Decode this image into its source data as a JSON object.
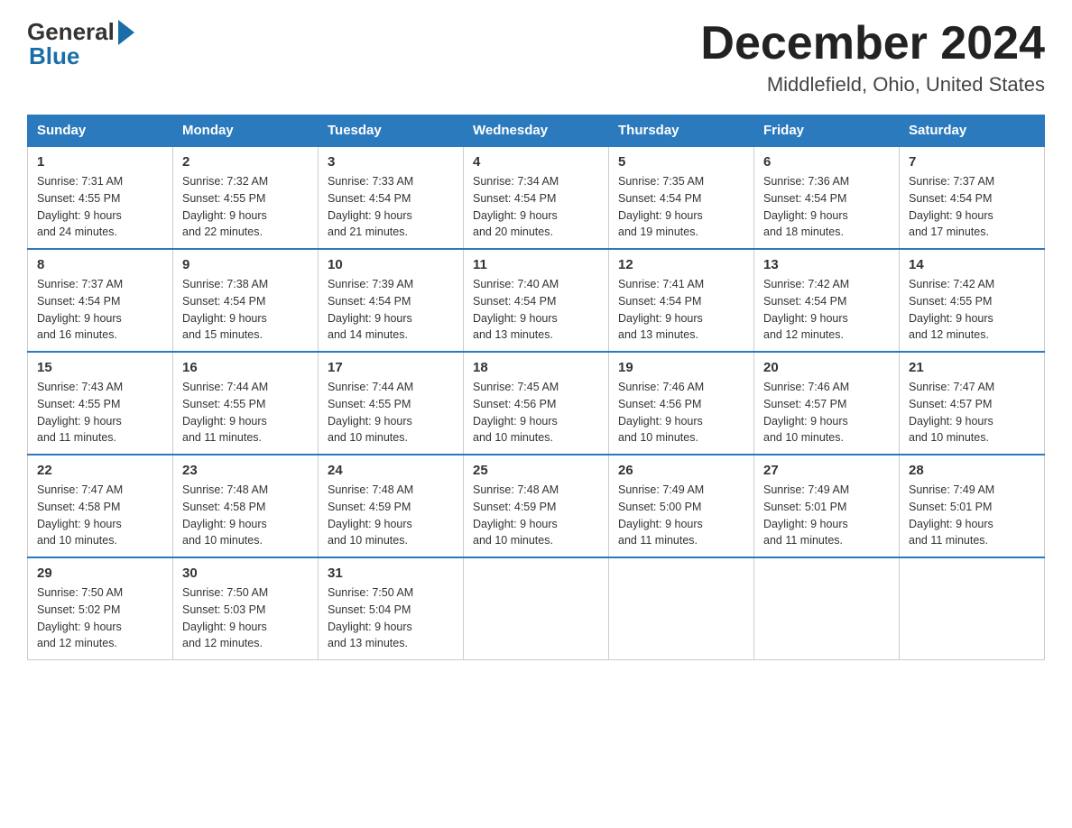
{
  "logo": {
    "general": "General",
    "blue": "Blue"
  },
  "title": "December 2024",
  "location": "Middlefield, Ohio, United States",
  "days_of_week": [
    "Sunday",
    "Monday",
    "Tuesday",
    "Wednesday",
    "Thursday",
    "Friday",
    "Saturday"
  ],
  "weeks": [
    [
      {
        "day": "1",
        "sunrise": "7:31 AM",
        "sunset": "4:55 PM",
        "daylight": "9 hours and 24 minutes."
      },
      {
        "day": "2",
        "sunrise": "7:32 AM",
        "sunset": "4:55 PM",
        "daylight": "9 hours and 22 minutes."
      },
      {
        "day": "3",
        "sunrise": "7:33 AM",
        "sunset": "4:54 PM",
        "daylight": "9 hours and 21 minutes."
      },
      {
        "day": "4",
        "sunrise": "7:34 AM",
        "sunset": "4:54 PM",
        "daylight": "9 hours and 20 minutes."
      },
      {
        "day": "5",
        "sunrise": "7:35 AM",
        "sunset": "4:54 PM",
        "daylight": "9 hours and 19 minutes."
      },
      {
        "day": "6",
        "sunrise": "7:36 AM",
        "sunset": "4:54 PM",
        "daylight": "9 hours and 18 minutes."
      },
      {
        "day": "7",
        "sunrise": "7:37 AM",
        "sunset": "4:54 PM",
        "daylight": "9 hours and 17 minutes."
      }
    ],
    [
      {
        "day": "8",
        "sunrise": "7:37 AM",
        "sunset": "4:54 PM",
        "daylight": "9 hours and 16 minutes."
      },
      {
        "day": "9",
        "sunrise": "7:38 AM",
        "sunset": "4:54 PM",
        "daylight": "9 hours and 15 minutes."
      },
      {
        "day": "10",
        "sunrise": "7:39 AM",
        "sunset": "4:54 PM",
        "daylight": "9 hours and 14 minutes."
      },
      {
        "day": "11",
        "sunrise": "7:40 AM",
        "sunset": "4:54 PM",
        "daylight": "9 hours and 13 minutes."
      },
      {
        "day": "12",
        "sunrise": "7:41 AM",
        "sunset": "4:54 PM",
        "daylight": "9 hours and 13 minutes."
      },
      {
        "day": "13",
        "sunrise": "7:42 AM",
        "sunset": "4:54 PM",
        "daylight": "9 hours and 12 minutes."
      },
      {
        "day": "14",
        "sunrise": "7:42 AM",
        "sunset": "4:55 PM",
        "daylight": "9 hours and 12 minutes."
      }
    ],
    [
      {
        "day": "15",
        "sunrise": "7:43 AM",
        "sunset": "4:55 PM",
        "daylight": "9 hours and 11 minutes."
      },
      {
        "day": "16",
        "sunrise": "7:44 AM",
        "sunset": "4:55 PM",
        "daylight": "9 hours and 11 minutes."
      },
      {
        "day": "17",
        "sunrise": "7:44 AM",
        "sunset": "4:55 PM",
        "daylight": "9 hours and 10 minutes."
      },
      {
        "day": "18",
        "sunrise": "7:45 AM",
        "sunset": "4:56 PM",
        "daylight": "9 hours and 10 minutes."
      },
      {
        "day": "19",
        "sunrise": "7:46 AM",
        "sunset": "4:56 PM",
        "daylight": "9 hours and 10 minutes."
      },
      {
        "day": "20",
        "sunrise": "7:46 AM",
        "sunset": "4:57 PM",
        "daylight": "9 hours and 10 minutes."
      },
      {
        "day": "21",
        "sunrise": "7:47 AM",
        "sunset": "4:57 PM",
        "daylight": "9 hours and 10 minutes."
      }
    ],
    [
      {
        "day": "22",
        "sunrise": "7:47 AM",
        "sunset": "4:58 PM",
        "daylight": "9 hours and 10 minutes."
      },
      {
        "day": "23",
        "sunrise": "7:48 AM",
        "sunset": "4:58 PM",
        "daylight": "9 hours and 10 minutes."
      },
      {
        "day": "24",
        "sunrise": "7:48 AM",
        "sunset": "4:59 PM",
        "daylight": "9 hours and 10 minutes."
      },
      {
        "day": "25",
        "sunrise": "7:48 AM",
        "sunset": "4:59 PM",
        "daylight": "9 hours and 10 minutes."
      },
      {
        "day": "26",
        "sunrise": "7:49 AM",
        "sunset": "5:00 PM",
        "daylight": "9 hours and 11 minutes."
      },
      {
        "day": "27",
        "sunrise": "7:49 AM",
        "sunset": "5:01 PM",
        "daylight": "9 hours and 11 minutes."
      },
      {
        "day": "28",
        "sunrise": "7:49 AM",
        "sunset": "5:01 PM",
        "daylight": "9 hours and 11 minutes."
      }
    ],
    [
      {
        "day": "29",
        "sunrise": "7:50 AM",
        "sunset": "5:02 PM",
        "daylight": "9 hours and 12 minutes."
      },
      {
        "day": "30",
        "sunrise": "7:50 AM",
        "sunset": "5:03 PM",
        "daylight": "9 hours and 12 minutes."
      },
      {
        "day": "31",
        "sunrise": "7:50 AM",
        "sunset": "5:04 PM",
        "daylight": "9 hours and 13 minutes."
      },
      null,
      null,
      null,
      null
    ]
  ],
  "labels": {
    "sunrise": "Sunrise:",
    "sunset": "Sunset:",
    "daylight": "Daylight:"
  }
}
